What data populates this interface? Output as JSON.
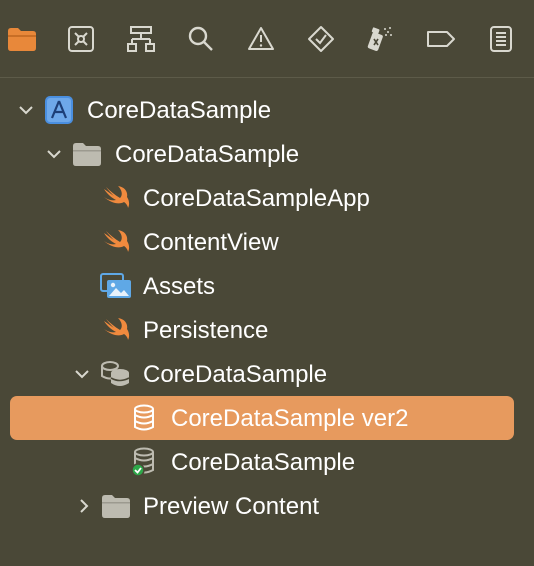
{
  "toolbar": {
    "icons": [
      {
        "name": "folder-icon",
        "active": true
      },
      {
        "name": "source-control-icon"
      },
      {
        "name": "hierarchy-icon"
      },
      {
        "name": "search-icon"
      },
      {
        "name": "warning-icon"
      },
      {
        "name": "test-icon"
      },
      {
        "name": "debug-icon"
      },
      {
        "name": "breakpoint-icon"
      },
      {
        "name": "report-icon"
      }
    ],
    "colors": {
      "active": "#e8883a",
      "inactive": "#d9d8cf"
    }
  },
  "tree": {
    "items": [
      {
        "label": "CoreDataSample",
        "kind": "project",
        "icon": "xcode-project-icon",
        "expanded": true
      },
      {
        "label": "CoreDataSample",
        "kind": "group",
        "icon": "folder-icon",
        "expanded": true
      },
      {
        "label": "CoreDataSampleApp",
        "kind": "file",
        "icon": "swift-icon"
      },
      {
        "label": "ContentView",
        "kind": "file",
        "icon": "swift-icon"
      },
      {
        "label": "Assets",
        "kind": "file",
        "icon": "assets-icon"
      },
      {
        "label": "Persistence",
        "kind": "file",
        "icon": "swift-icon"
      },
      {
        "label": "CoreDataSample",
        "kind": "model-group",
        "icon": "data-model-group-icon",
        "expanded": true
      },
      {
        "label": "CoreDataSample ver2",
        "kind": "model-version",
        "icon": "database-icon",
        "selected": true
      },
      {
        "label": "CoreDataSample",
        "kind": "model-version",
        "icon": "database-current-icon"
      },
      {
        "label": "Preview Content",
        "kind": "group",
        "icon": "folder-icon",
        "expanded": false
      }
    ]
  },
  "colors": {
    "background": "#4a4837",
    "selection": "#e79a5e",
    "swift": "#f08a3e",
    "folder": "#bdbbb0",
    "project": "#4a8fe0",
    "check": "#2ea84a"
  }
}
